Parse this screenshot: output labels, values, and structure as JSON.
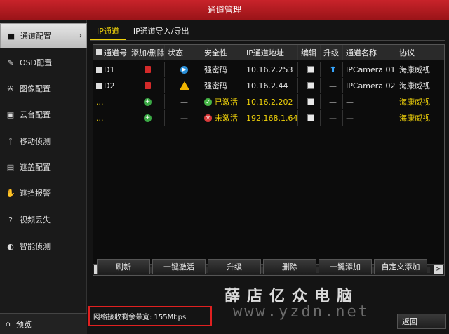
{
  "window": {
    "title": "通道管理"
  },
  "sidebar": {
    "items": [
      {
        "label": "通道配置",
        "icon": "camera-icon",
        "active": true
      },
      {
        "label": "OSD配置",
        "icon": "pen-icon",
        "active": false
      },
      {
        "label": "图像配置",
        "icon": "aperture-icon",
        "active": false
      },
      {
        "label": "云台配置",
        "icon": "ptz-icon",
        "active": false
      },
      {
        "label": "移动侦测",
        "icon": "running-person-icon",
        "active": false
      },
      {
        "label": "遮盖配置",
        "icon": "mask-icon",
        "active": false
      },
      {
        "label": "遮挡报警",
        "icon": "hand-icon",
        "active": false
      },
      {
        "label": "视频丢失",
        "icon": "question-box-icon",
        "active": false
      },
      {
        "label": "智能侦测",
        "icon": "smart-detect-icon",
        "active": false
      }
    ],
    "preview_label": "预览"
  },
  "tabs": [
    {
      "label": "IP通道",
      "active": true
    },
    {
      "label": "IP通道导入/导出",
      "active": false
    }
  ],
  "table": {
    "headers": [
      "通道号",
      "添加/删除",
      "状态",
      "安全性",
      "IP通道地址",
      "编辑",
      "升级",
      "通道名称",
      "协议"
    ],
    "rows": [
      {
        "channel": "D1",
        "action": "delete",
        "status": "play",
        "security": "强密码",
        "ip": "10.16.2.253",
        "upgrade": "up",
        "name": "IPCamera 01",
        "protocol": "海康威视",
        "highlight": false
      },
      {
        "channel": "D2",
        "action": "delete",
        "status": "warning",
        "security": "强密码",
        "ip": "10.16.2.44",
        "upgrade": "—",
        "name": "IPCamera 02",
        "protocol": "海康威视",
        "highlight": false
      },
      {
        "channel": "...",
        "action": "add",
        "status": "—",
        "security": "已激活",
        "security_state": "ok",
        "ip": "10.16.2.202",
        "upgrade": "—",
        "name": "—",
        "protocol": "海康威视",
        "highlight": true
      },
      {
        "channel": "...",
        "action": "add",
        "status": "—",
        "security": "未激活",
        "security_state": "no",
        "ip": "192.168.1.64",
        "upgrade": "—",
        "name": "—",
        "protocol": "海康威视",
        "highlight": true
      }
    ]
  },
  "scrollbar": {
    "left_arrow": "<",
    "right_arrow": ">"
  },
  "buttons": [
    "刷新",
    "一键激活",
    "升级",
    "删除",
    "一键添加",
    "自定义添加"
  ],
  "bandwidth_text": "网络接收剩余带宽: 155Mbps",
  "back_label": "返回",
  "watermark": {
    "text": "薛店亿众电脑",
    "url": "www.yzdn.net"
  },
  "colors": {
    "title_red": "#b81c22",
    "highlight_yellow": "#f0d20a",
    "alert_red": "#e02020"
  }
}
